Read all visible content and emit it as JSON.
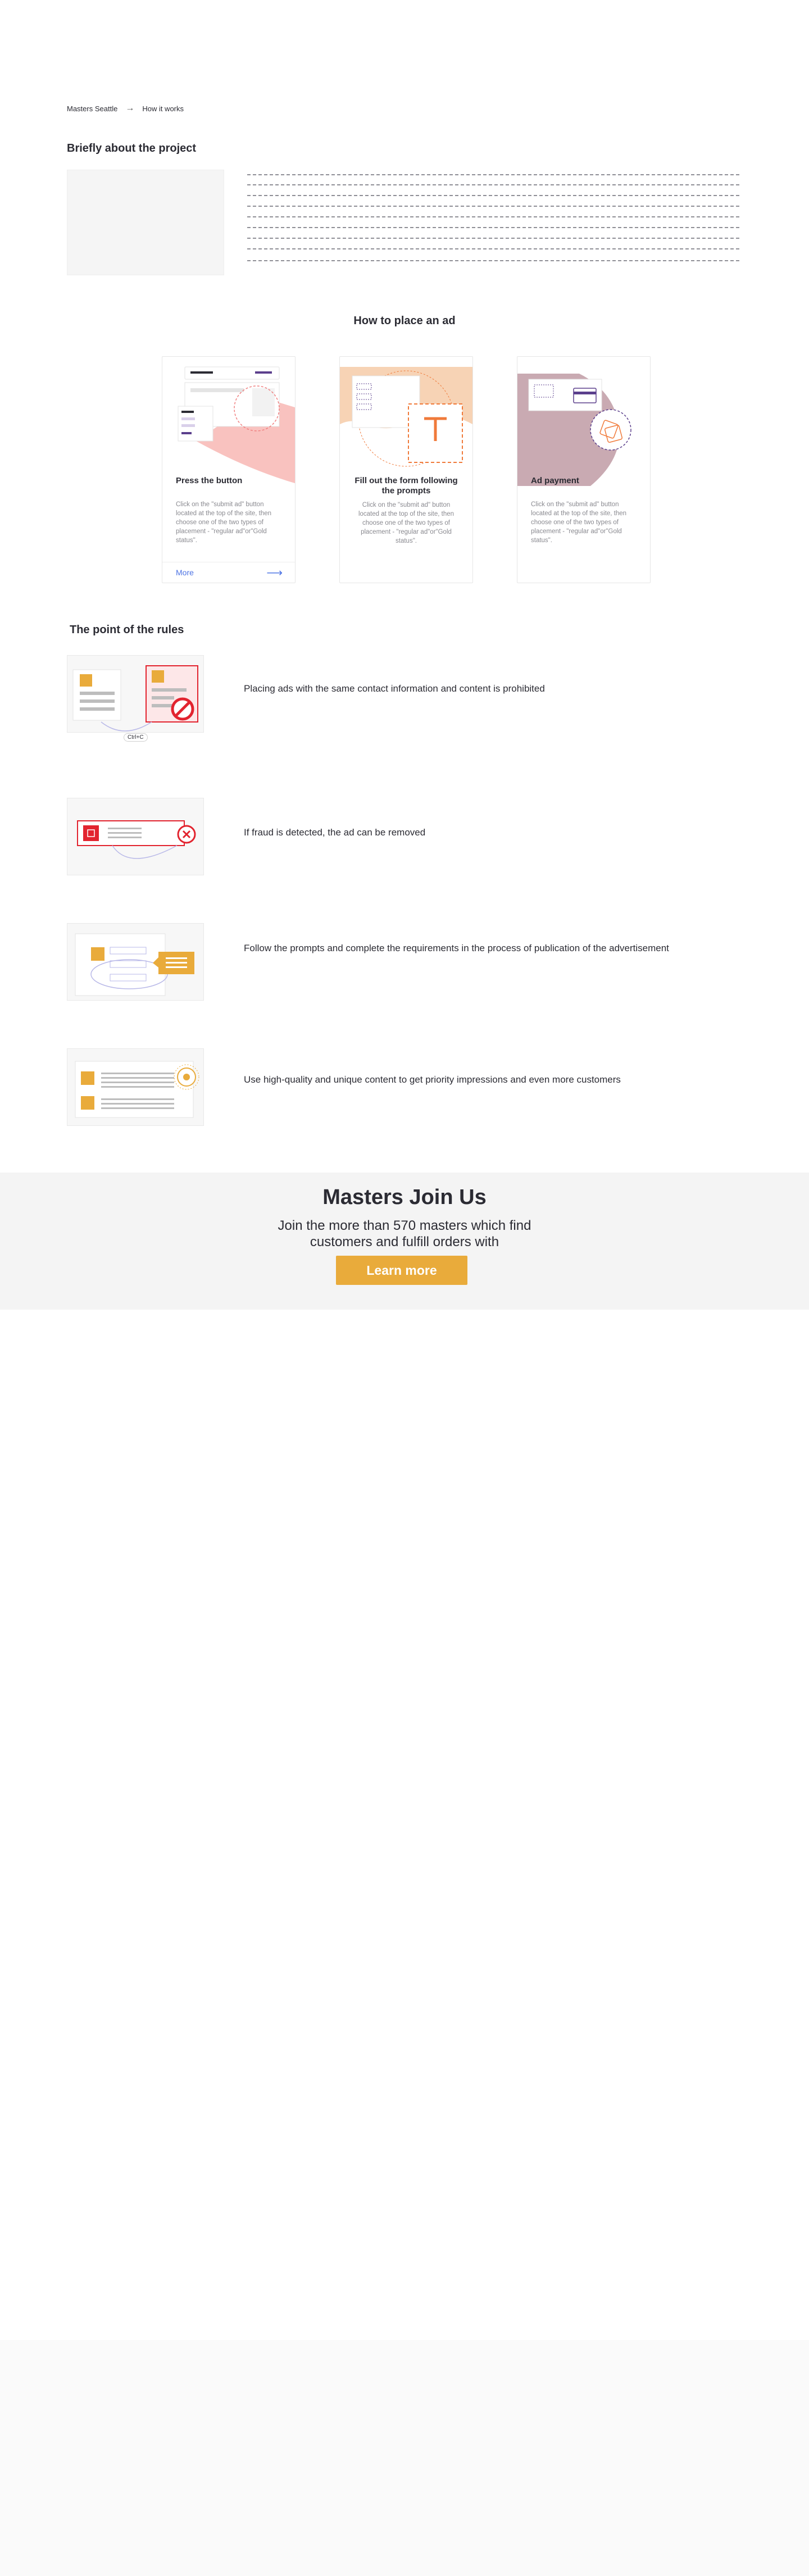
{
  "breadcrumb": {
    "home": "Masters Seattle",
    "current": "How it works"
  },
  "about": {
    "title": "Briefly about the project"
  },
  "how": {
    "title": "How to place an ad",
    "cards": [
      {
        "title": "Press the button",
        "desc": "Click on the \"submit ad\" button located at the top of the site, then choose one of the two types of placement - \"regular ad\"or\"Gold status\".",
        "more": "More"
      },
      {
        "title": "Fill out the form following the prompts",
        "desc": "Click on the \"submit ad\" button located at the top of the site, then choose one of the two types of placement - \"regular ad\"or\"Gold status\"."
      },
      {
        "title": "Ad payment",
        "desc": "Click on the \"submit ad\" button located at the top of the site, then choose one of the two types of placement - \"regular ad\"or\"Gold status\"."
      }
    ]
  },
  "rules": {
    "title": "The point of the rules",
    "items": [
      {
        "text": "Placing ads with the same contact information and content is prohibited",
        "badge": "Ctrl+C"
      },
      {
        "text": "If fraud is detected, the ad can be removed"
      },
      {
        "text": "Follow the prompts and complete the requirements in the process of publication of the advertisement"
      },
      {
        "text": "Use high-quality and unique content to get priority impressions and even more customers"
      }
    ]
  },
  "cta": {
    "title": "Masters Join Us",
    "subtitle": "Join the more than 570 masters which find customers and fulfill orders with",
    "button": "Learn more"
  },
  "colors": {
    "accent": "#e9ab3b",
    "link": "#4e74e4",
    "danger": "#e2242f",
    "purple": "#5b3f8c",
    "orange": "#f07a3a"
  }
}
